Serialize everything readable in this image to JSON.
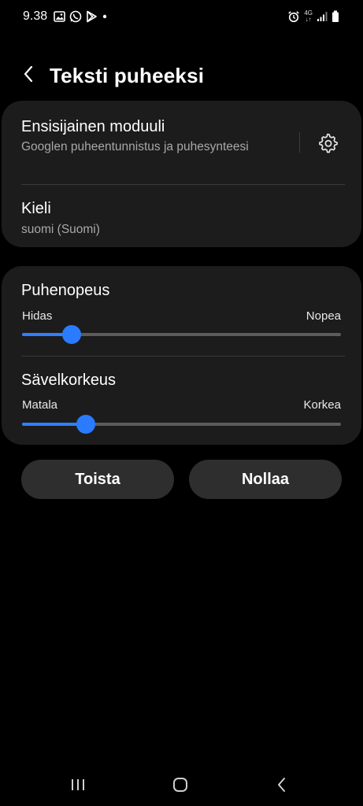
{
  "status_bar": {
    "time": "9.38",
    "network_label_top": "4G",
    "network_label_bottom": "↓↑",
    "left_icons": [
      "gallery-icon",
      "whatsapp-icon",
      "play-store-icon",
      "dot-icon"
    ],
    "right_icons": [
      "alarm-icon",
      "network-4g-icon",
      "signal-icon",
      "battery-icon"
    ]
  },
  "header": {
    "title": "Teksti puheeksi",
    "back_icon": "back-chevron-icon"
  },
  "engine_card": {
    "engine_title": "Ensisijainen moduuli",
    "engine_value": "Googlen puheentunnistus ja puhesynteesi",
    "settings_icon": "gear-icon",
    "language_title": "Kieli",
    "language_value": "suomi (Suomi)"
  },
  "sliders_card": {
    "rate": {
      "title": "Puhenopeus",
      "min_label": "Hidas",
      "max_label": "Nopea",
      "value_fraction": 0.155
    },
    "pitch": {
      "title": "Sävelkorkeus",
      "min_label": "Matala",
      "max_label": "Korkea",
      "value_fraction": 0.2
    },
    "accent_color": "#2f7fff"
  },
  "buttons": {
    "play_label": "Toista",
    "reset_label": "Nollaa"
  },
  "nav_bar": {
    "icons": [
      "recent-apps-icon",
      "home-icon",
      "back-icon"
    ]
  }
}
